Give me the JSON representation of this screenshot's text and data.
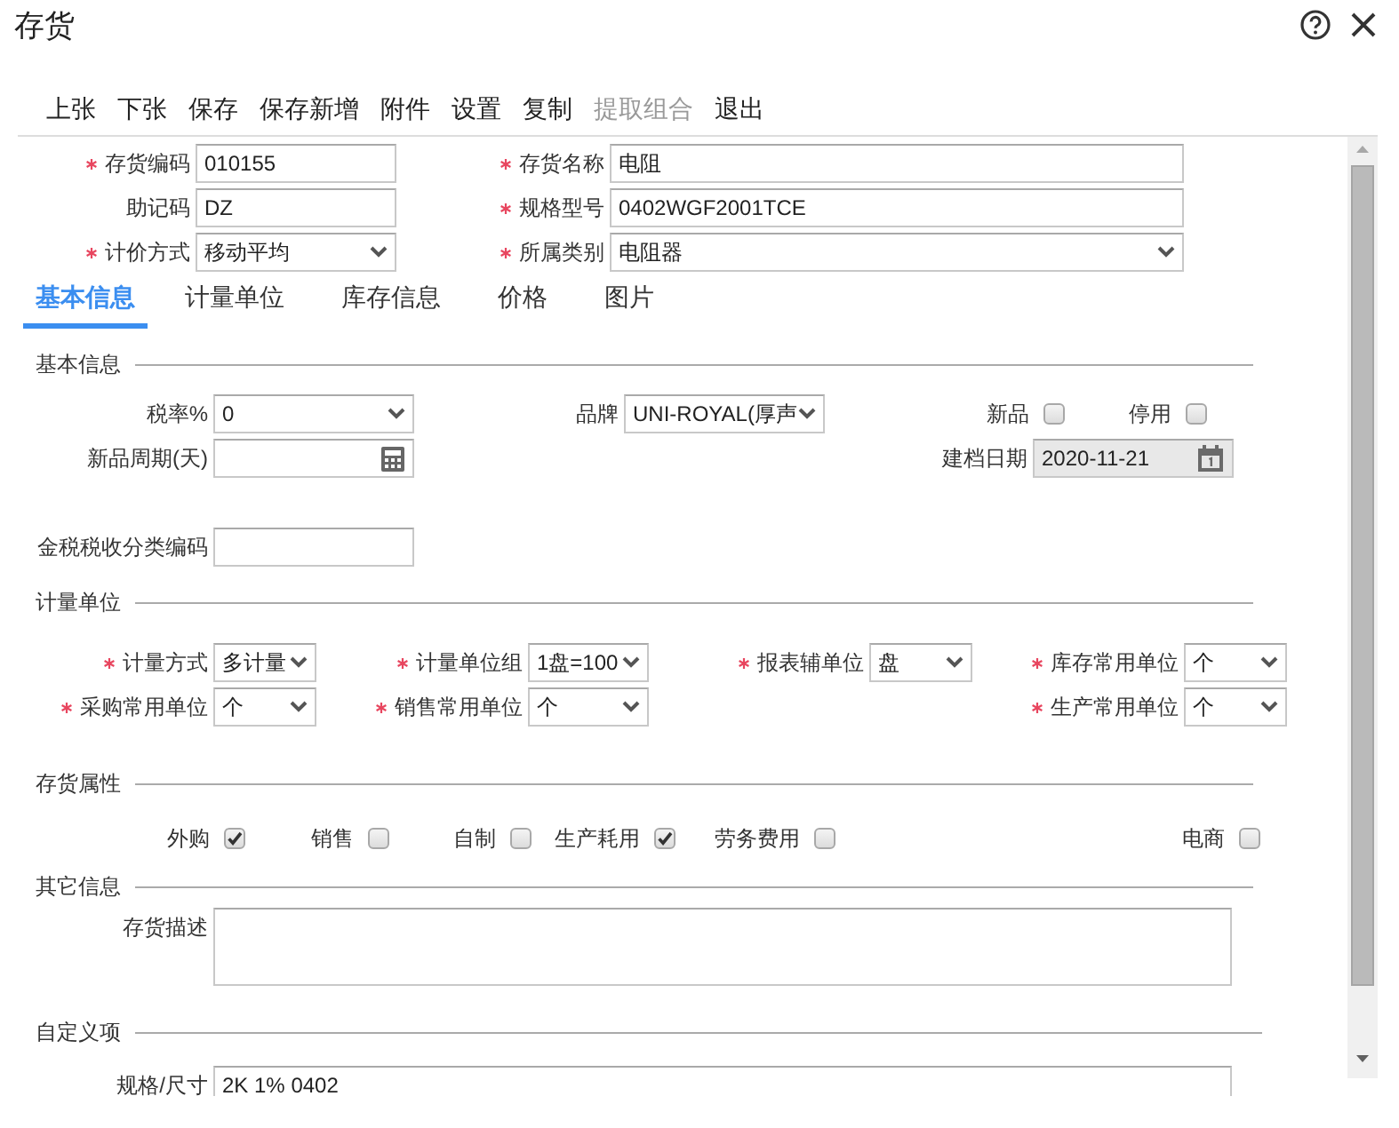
{
  "window": {
    "title": "存货"
  },
  "toolbar": [
    {
      "label": "上张",
      "disabled": false
    },
    {
      "label": "下张",
      "disabled": false
    },
    {
      "label": "保存",
      "disabled": false
    },
    {
      "label": "保存新增",
      "disabled": false
    },
    {
      "label": "附件",
      "disabled": false
    },
    {
      "label": "设置",
      "disabled": false
    },
    {
      "label": "复制",
      "disabled": false
    },
    {
      "label": "提取组合",
      "disabled": true
    },
    {
      "label": "退出",
      "disabled": false
    }
  ],
  "header_rows": [
    [
      {
        "label": "存货编码",
        "required": true,
        "kind": "text",
        "value": "010155",
        "disabled": false
      },
      {
        "label": "存货名称",
        "required": true,
        "kind": "text",
        "value": "电阻",
        "disabled": false
      }
    ],
    [
      {
        "label": "助记码",
        "required": false,
        "kind": "text",
        "value": "DZ",
        "disabled": false
      },
      {
        "label": "规格型号",
        "required": true,
        "kind": "text",
        "value": "0402WGF2001TCE",
        "disabled": false
      }
    ],
    [
      {
        "label": "计价方式",
        "required": true,
        "kind": "select",
        "value": "移动平均",
        "disabled": false
      },
      {
        "label": "所属类别",
        "required": true,
        "kind": "select",
        "value": "电阻器",
        "disabled": false
      }
    ]
  ],
  "tabs": [
    {
      "label": "基本信息",
      "selected": true
    },
    {
      "label": "计量单位",
      "selected": false
    },
    {
      "label": "库存信息",
      "selected": false
    },
    {
      "label": "价格",
      "selected": false
    },
    {
      "label": "图片",
      "selected": false
    }
  ],
  "sections": [
    {
      "title": "基本信息",
      "rows": [
        [
          {
            "label": "税率%",
            "required": false,
            "kind": "select",
            "value": "0",
            "disabled": false
          },
          {
            "label": "品牌",
            "required": false,
            "kind": "select",
            "value": "UNI-ROYAL(厚声",
            "disabled": false
          },
          {
            "label": "新品",
            "required": false,
            "kind": "checkbox",
            "checked": false
          },
          {
            "label": "停用",
            "required": false,
            "kind": "checkbox",
            "checked": false
          }
        ],
        [
          {
            "label": "新品周期(天)",
            "required": false,
            "kind": "number",
            "disabled": false
          },
          "",
          {
            "label": "建档日期",
            "required": false,
            "kind": "date",
            "value": "2020-11-21",
            "disabled": true
          }
        ],
        [
          {
            "label": "金税税收分类编码",
            "required": false,
            "kind": "text",
            "disabled": false
          }
        ]
      ]
    },
    {
      "title": "计量单位",
      "rows": [
        [
          {
            "label": "计量方式",
            "required": true,
            "kind": "select",
            "value": "多计量",
            "disabled": false
          },
          {
            "label": "计量单位组",
            "required": true,
            "kind": "select",
            "value": "1盘=100",
            "disabled": false
          },
          {
            "label": "报表辅单位",
            "required": true,
            "kind": "select",
            "value": "盘",
            "disabled": false
          },
          {
            "label": "库存常用单位",
            "required": true,
            "kind": "select",
            "value": "个",
            "disabled": false
          }
        ],
        [
          {
            "label": "采购常用单位",
            "required": true,
            "kind": "select",
            "value": "个",
            "disabled": false
          },
          {
            "label": "销售常用单位",
            "required": true,
            "kind": "select",
            "value": "个",
            "disabled": false
          },
          "",
          {
            "label": "生产常用单位",
            "required": true,
            "kind": "select",
            "value": "个",
            "disabled": false
          }
        ]
      ]
    },
    {
      "title": "存货属性",
      "rows": [
        [
          {
            "label": "外购",
            "required": false,
            "kind": "checkbox",
            "checked": true
          },
          {
            "label": "销售",
            "required": false,
            "kind": "checkbox",
            "checked": false
          },
          {
            "label": "自制",
            "required": false,
            "kind": "checkbox",
            "checked": false
          },
          {
            "label": "生产耗用",
            "required": false,
            "kind": "checkbox",
            "checked": true
          },
          {
            "label": "劳务费用",
            "required": false,
            "kind": "checkbox",
            "checked": false
          },
          {
            "label": "电商",
            "required": false,
            "kind": "checkbox",
            "checked": false
          }
        ]
      ]
    },
    {
      "title": "其它信息",
      "rows": [
        [
          {
            "label": "存货描述",
            "required": false,
            "kind": "textarea",
            "disabled": false
          }
        ]
      ]
    },
    {
      "title": "自定义项",
      "rows": [
        [
          {
            "label": "规格/尺寸",
            "required": false,
            "kind": "text",
            "value": "2K 1% 0402",
            "disabled": false
          }
        ]
      ]
    }
  ]
}
